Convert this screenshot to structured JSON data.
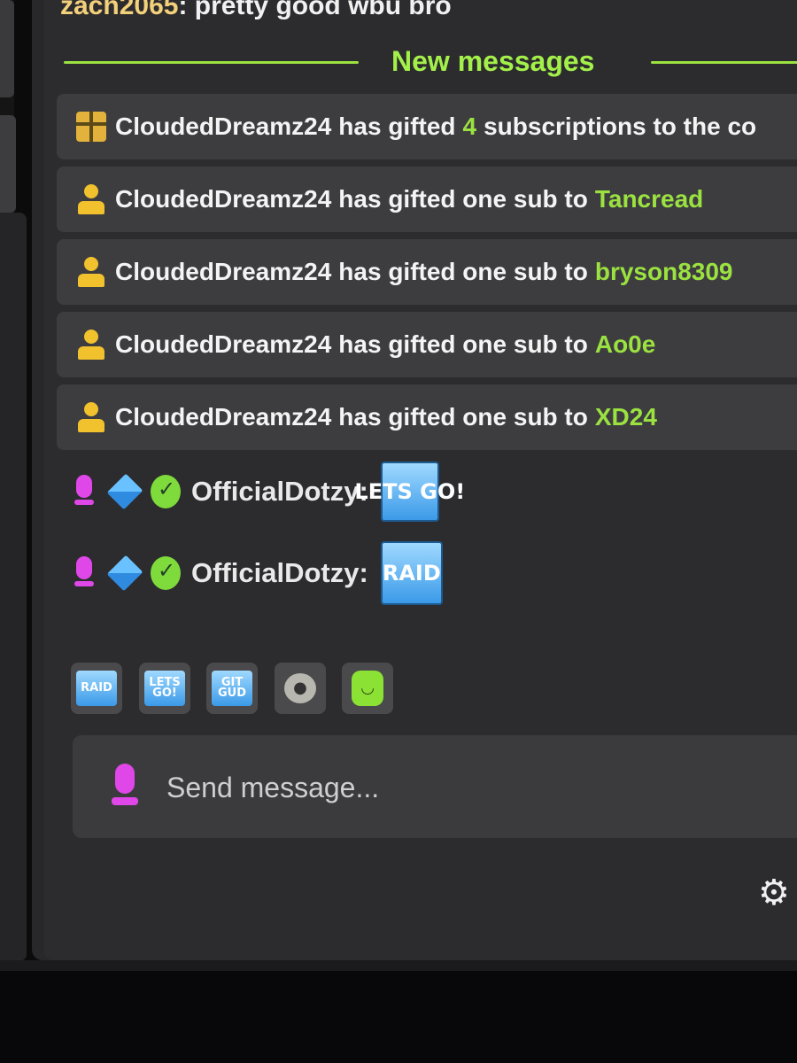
{
  "top_message": {
    "user": "zach2065",
    "text": ": pretty good wbu bro"
  },
  "divider_label": "New messages",
  "events": [
    {
      "icon": "gift-icon",
      "user": "CloudedDreamz24",
      "pre": "has gifted",
      "highlight": "4",
      "post": "subscriptions to the co"
    },
    {
      "icon": "person-icon",
      "user": "CloudedDreamz24",
      "pre": "has gifted one sub to",
      "highlight": "Tancread",
      "post": ""
    },
    {
      "icon": "person-icon",
      "user": "CloudedDreamz24",
      "pre": "has gifted one sub to",
      "highlight": "bryson8309",
      "post": ""
    },
    {
      "icon": "person-icon",
      "user": "CloudedDreamz24",
      "pre": "has gifted one sub to",
      "highlight": "Ao0e",
      "post": ""
    },
    {
      "icon": "person-icon",
      "user": "CloudedDreamz24",
      "pre": "has gifted one sub to",
      "highlight": "XD24",
      "post": ""
    }
  ],
  "chat": [
    {
      "user": "OfficialDotzy:",
      "emote": "LETS GO!"
    },
    {
      "user": "OfficialDotzy:",
      "emote": "RAID"
    }
  ],
  "quick_emotes": [
    "RAID",
    "LETS GO!",
    "GIT GUD",
    "seal",
    "angel"
  ],
  "input": {
    "placeholder": "Send message..."
  },
  "colors": {
    "accent": "#9be240",
    "badge": "#e047e8",
    "gift": "#f2c12e"
  }
}
